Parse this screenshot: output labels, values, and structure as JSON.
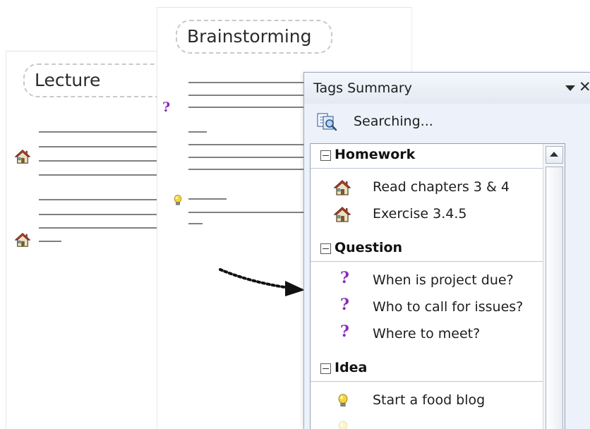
{
  "pages": {
    "lecture": {
      "title": "Lecture"
    },
    "brainstorming": {
      "title": "Brainstorming"
    }
  },
  "tags_panel": {
    "title": "Tags Summary",
    "dropdown_icon": "chevron-down-icon",
    "close_glyph": "✕",
    "search_status": "Searching...",
    "groups": [
      {
        "label": "Homework",
        "icon": "house-icon",
        "items": [
          {
            "label": "Read chapters 3 & 4"
          },
          {
            "label": "Exercise 3.4.5"
          }
        ]
      },
      {
        "label": "Question",
        "icon": "question-icon",
        "items": [
          {
            "label": "When is project due?"
          },
          {
            "label": "Who to call for issues?"
          },
          {
            "label": "Where to meet?"
          }
        ]
      },
      {
        "label": "Idea",
        "icon": "lightbulb-icon",
        "items": [
          {
            "label": "Start a food blog"
          }
        ]
      }
    ]
  },
  "colors": {
    "question_mark": "#8a2bbd",
    "panel_background": "#edf2fa",
    "panel_border": "#9aa8bd"
  }
}
